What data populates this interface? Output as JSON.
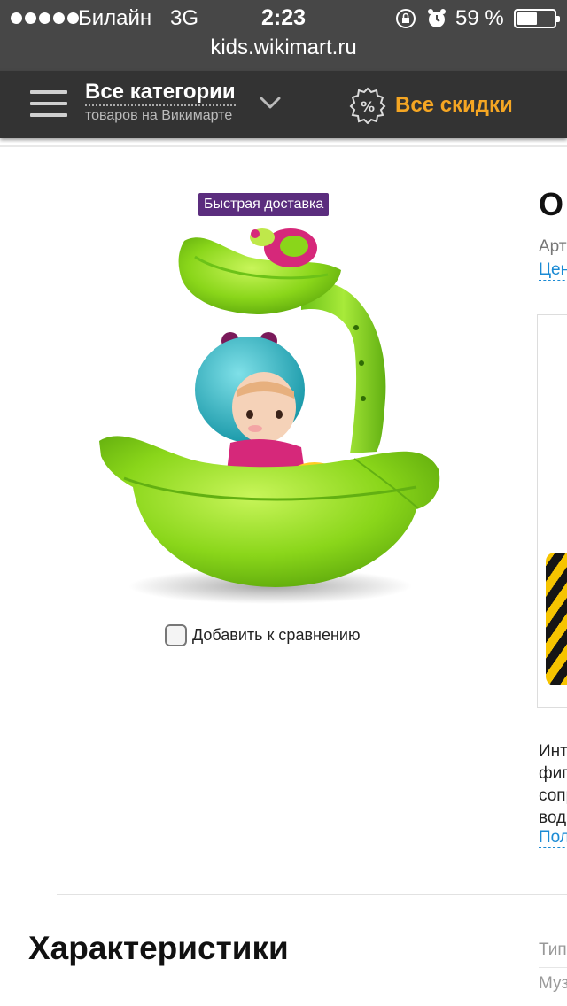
{
  "status_bar": {
    "carrier": "Билайн",
    "network": "3G",
    "time": "2:23",
    "battery_percent": "59 %",
    "battery_level": 0.59,
    "icons": [
      "signal-dots-icon",
      "rotation-lock-icon",
      "alarm-icon",
      "battery-icon"
    ]
  },
  "browser": {
    "url": "kids.wikimart.ru"
  },
  "nav": {
    "categories_title": "Все категории",
    "categories_subtitle": "товаров на Викимарте",
    "discounts_label": "Все скидки",
    "discount_icon_symbol": "%",
    "accent_color": "#f5a623"
  },
  "product": {
    "badge": "Быстрая доставка",
    "badge_color": "#5b2d7e",
    "compare_label": "Добавить к сравнению",
    "title_fragment": "О",
    "article_fragment": "Арт",
    "price_link_fragment": "Цен",
    "description_fragments": [
      "Инт",
      "фиг",
      "сопр",
      "вод"
    ],
    "more_link_fragment": "Пол",
    "link_color": "#1a8ad4"
  },
  "specs": {
    "heading": "Характеристики",
    "rows": [
      "Тип",
      "Муз"
    ]
  }
}
